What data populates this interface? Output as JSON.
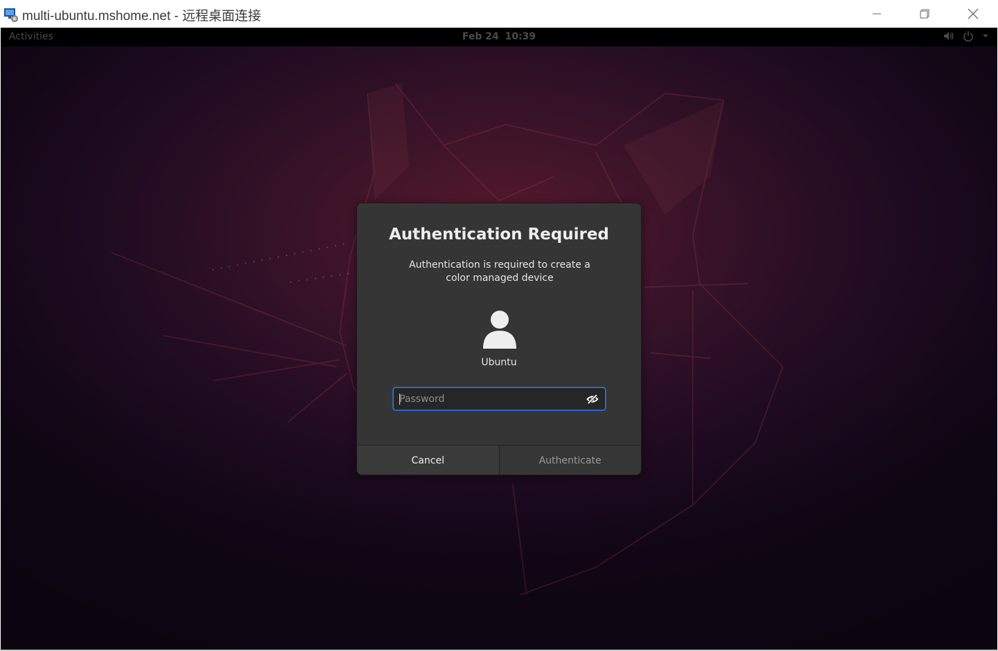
{
  "window": {
    "title": "multi-ubuntu.mshome.net - 远程桌面连接",
    "controls": {
      "minimize_icon": "minimize-icon",
      "restore_icon": "restore-icon",
      "close_icon": "close-icon"
    }
  },
  "top_bar": {
    "activities": "Activities",
    "date": "Feb 24",
    "time": "10:39",
    "icons": [
      "volume-icon",
      "power-icon",
      "chevron-down-icon"
    ]
  },
  "dialog": {
    "title": "Authentication Required",
    "description": "Authentication is required to create a color managed device",
    "user": {
      "avatar_icon": "user-avatar-icon",
      "name": "Ubuntu"
    },
    "password": {
      "placeholder": "Password",
      "value": "",
      "reveal_icon": "eye-hidden-icon"
    },
    "buttons": {
      "cancel": "Cancel",
      "authenticate": "Authenticate"
    }
  },
  "colors": {
    "focus_accent": "#2a69c7",
    "dialog_bg": "#353535",
    "wallpaper_base": "#2a0f2c"
  }
}
